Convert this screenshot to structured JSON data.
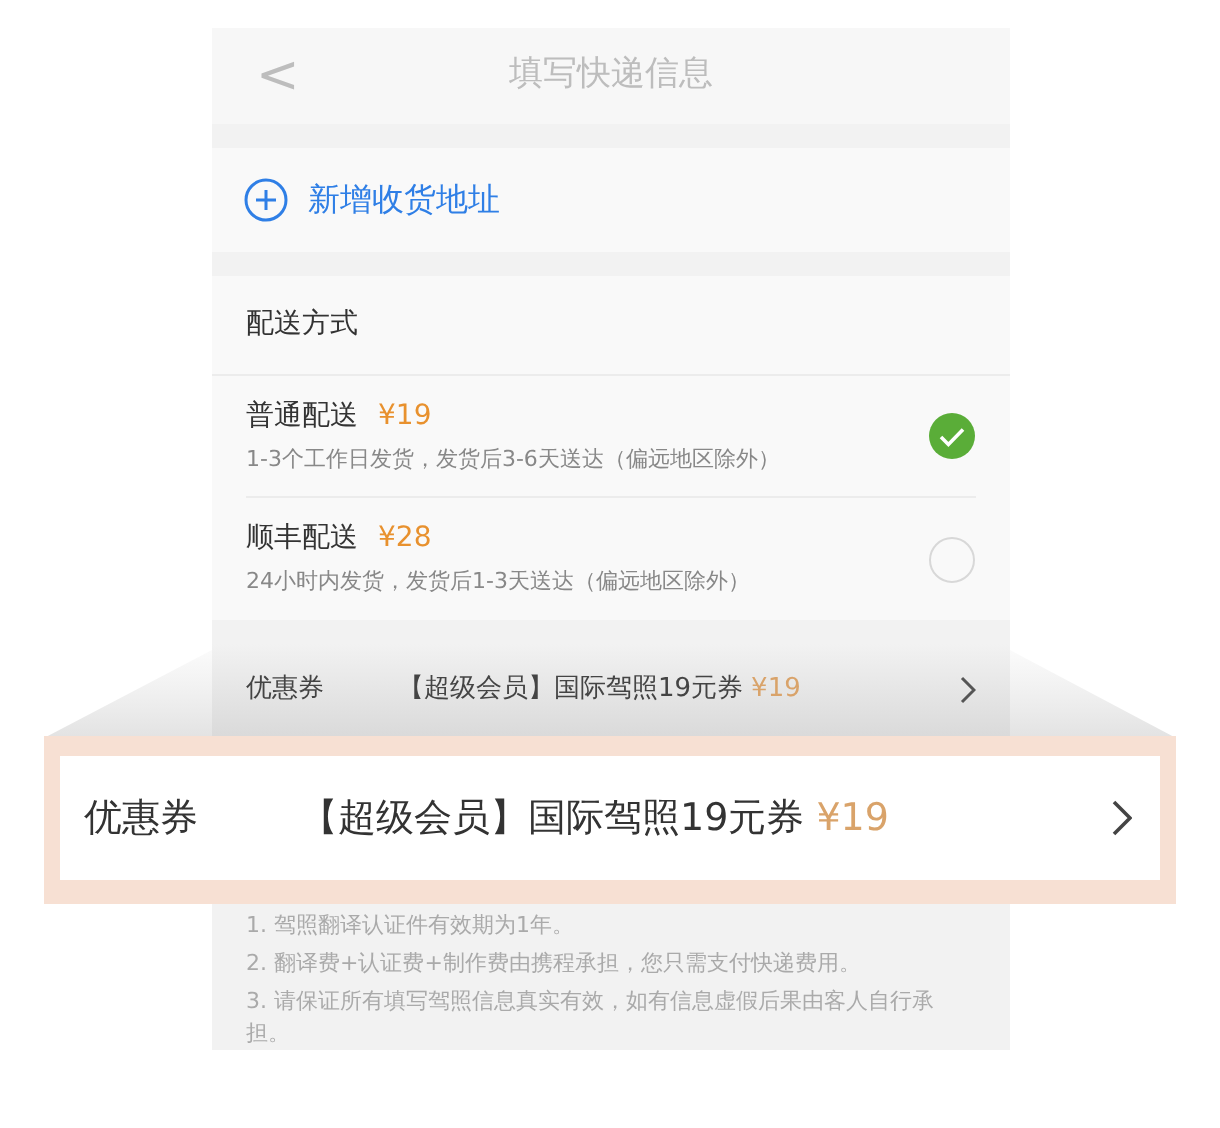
{
  "nav": {
    "back": "<",
    "title": "填写快递信息"
  },
  "add_address": {
    "label": "新增收货地址"
  },
  "delivery": {
    "heading": "配送方式",
    "options": [
      {
        "name": "普通配送",
        "price": "¥19",
        "note": "1-3个工作日发货，发货后3-6天送达（偏远地区除外）",
        "selected": true
      },
      {
        "name": "顺丰配送",
        "price": "¥28",
        "note": "24小时内发货，发货后1-3天送达（偏远地区除外）",
        "selected": false
      }
    ]
  },
  "coupon": {
    "label": "优惠券",
    "value": "【超级会员】国际驾照19元券",
    "price": "¥19"
  },
  "callout": {
    "label": "优惠券",
    "value": "【超级会员】国际驾照19元券",
    "price": "¥19"
  },
  "notes": [
    "1. 驾照翻译认证件有效期为1年。",
    "2. 翻译费+认证费+制作费由携程承担，您只需支付快递费用。",
    "3. 请保证所有填写驾照信息真实有效，如有信息虚假后果由客人自行承担。"
  ]
}
